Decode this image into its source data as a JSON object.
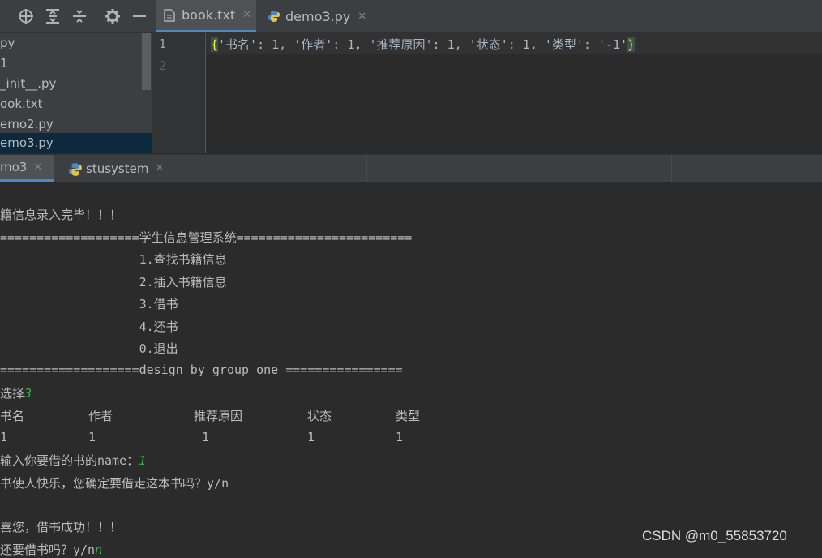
{
  "toolbar": {
    "icons": [
      "crosshair-icon",
      "expand-all-icon",
      "collapse-all-icon",
      "gear-icon",
      "minimize-icon"
    ]
  },
  "editor_tabs": [
    {
      "label": "book.txt",
      "icon": "text-file-icon",
      "active": true
    },
    {
      "label": "demo3.py",
      "icon": "python-file-icon",
      "active": false
    }
  ],
  "project_tree": {
    "items": [
      "py",
      "1",
      "_init__.py",
      "ook.txt",
      "emo2.py",
      "emo3.py"
    ],
    "selected_index": 5
  },
  "editor": {
    "line_numbers": [
      "1",
      "2"
    ],
    "line1": {
      "open_brace": "{",
      "content": "'书名': 1, '作者': 1, '推荐原因': 1, '状态': 1, '类型': '-1'",
      "close_brace": "}"
    }
  },
  "run_tabs": [
    {
      "label": "mo3",
      "active": true
    },
    {
      "label": "stusystem",
      "active": false
    }
  ],
  "console": {
    "lines": [
      "籍信息录入完毕！！！",
      "===================学生信息管理系统========================",
      "                   1.查找书籍信息",
      "                   2.插入书籍信息",
      "                   3.借书",
      "                   4.还书",
      "                   0.退出",
      "===================design by group one ================"
    ],
    "prompt_choose": "选择",
    "choose_input": "3",
    "table_headers": [
      "书名",
      "作者",
      "推荐原因",
      "状态",
      "类型"
    ],
    "table_values": [
      "1",
      "1",
      "1",
      "1",
      "1"
    ],
    "prompt_name": "输入你要借的书的name：",
    "name_input": "1",
    "prompt_confirm": "书使人快乐，您确定要借走这本书吗？y/n",
    "success": "喜您，借书成功！！！",
    "prompt_again": "还要借书吗？y/n",
    "again_input": "n"
  },
  "watermark": "CSDN @m0_55853720"
}
